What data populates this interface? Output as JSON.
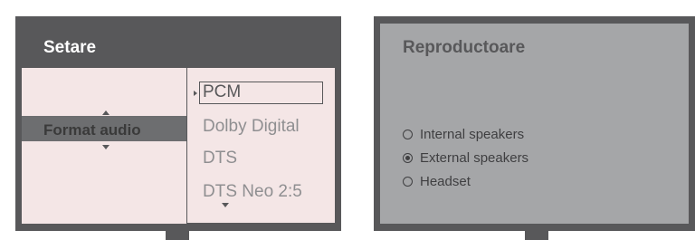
{
  "left": {
    "title": "Setare",
    "setting_label": "Format audio",
    "options": [
      "PCM",
      "Dolby Digital",
      "DTS",
      "DTS Neo 2:5"
    ],
    "selected_index": 0
  },
  "right": {
    "title": "Reproductoare",
    "radios": [
      {
        "label": "Internal speakers",
        "checked": false
      },
      {
        "label": "External speakers",
        "checked": true
      },
      {
        "label": "Headset",
        "checked": false
      }
    ]
  },
  "colors": {
    "frame": "#58585a",
    "left_panel_bg": "#f4e6e6",
    "right_panel_bg": "#a5a6a8",
    "highlight_bar": "#6d6e70"
  }
}
